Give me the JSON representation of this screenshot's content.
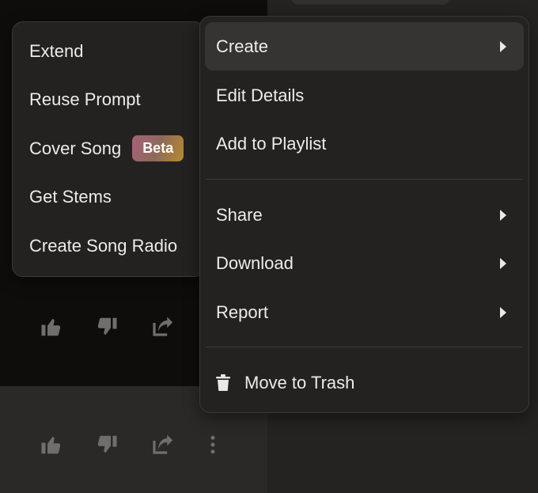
{
  "submenu": {
    "items": [
      {
        "label": "Extend"
      },
      {
        "label": "Reuse Prompt"
      },
      {
        "label": "Cover Song",
        "badge": "Beta"
      },
      {
        "label": "Get Stems"
      },
      {
        "label": "Create Song Radio"
      }
    ]
  },
  "menu": {
    "items": [
      {
        "label": "Create",
        "has_submenu": true,
        "active": true
      },
      {
        "label": "Edit Details"
      },
      {
        "label": "Add to Playlist"
      },
      {
        "label": "Share",
        "has_submenu": true
      },
      {
        "label": "Download",
        "has_submenu": true
      },
      {
        "label": "Report",
        "has_submenu": true
      },
      {
        "label": "Move to Trash",
        "icon": "trash-icon"
      }
    ]
  },
  "song_actions": {
    "icons": [
      "thumbs-up-icon",
      "thumbs-down-icon",
      "share-icon",
      "more-options-icon"
    ]
  },
  "colors": {
    "menu_bg": "#232221",
    "active_item_bg": "#353432",
    "badge_gradient": [
      "#a8607b",
      "#b68a2f"
    ]
  }
}
